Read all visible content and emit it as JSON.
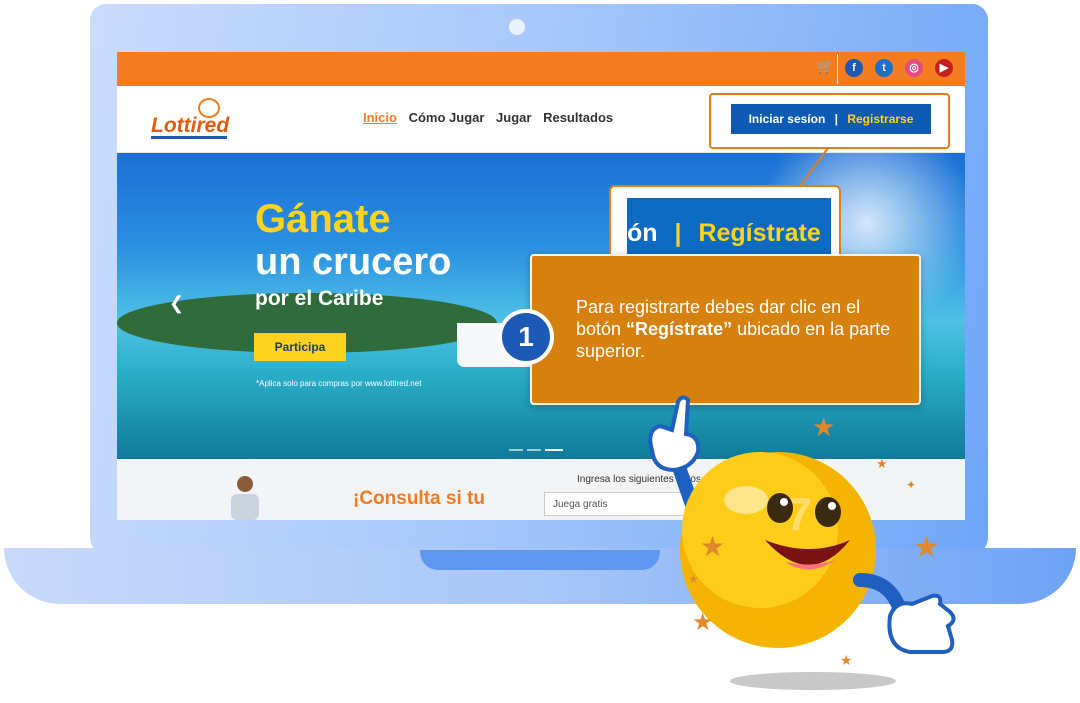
{
  "topbar": {
    "icons": [
      {
        "name": "cart-icon"
      },
      {
        "name": "facebook-icon",
        "label": "f",
        "color": "#1f59b0"
      },
      {
        "name": "twitter-icon",
        "label": "t",
        "color": "#1f6ec8"
      },
      {
        "name": "instagram-icon",
        "label": "◎",
        "color": "#e64b7f"
      },
      {
        "name": "youtube-icon",
        "label": "▶",
        "color": "#c81e1e"
      }
    ]
  },
  "header": {
    "logo_text": "Lottired",
    "nav": [
      "Inicio",
      "Cómo Jugar",
      "Jugar",
      "Resultados"
    ],
    "login_label": "Iniciar sesíon",
    "register_label": "Registrarse"
  },
  "hero": {
    "title_line1": "Gánate",
    "title_line2": "un crucero",
    "title_line3": "por el Caribe",
    "button_label": "Participa",
    "note": "*Aplica solo para compras por www.lottired.net"
  },
  "lower": {
    "consulta_title": "¡Consulta si tu",
    "ingresa_text": "Ingresa los siguientes datos y ¡descu",
    "juega_input": "Juega gratis"
  },
  "callout": {
    "zoom_prefix": "ón",
    "zoom_separator": "|",
    "zoom_label": "Regístrate",
    "step_number": "1",
    "tip_part1": "Para registrarte debes dar clic en el botón ",
    "tip_bold": "“Regístrate”",
    "tip_part2": " ubicado en la parte superior."
  },
  "colors": {
    "orange": "#f47c20",
    "blue": "#0d5bb5",
    "yellow": "#ffd21f",
    "tooltip": "#d6800e"
  }
}
